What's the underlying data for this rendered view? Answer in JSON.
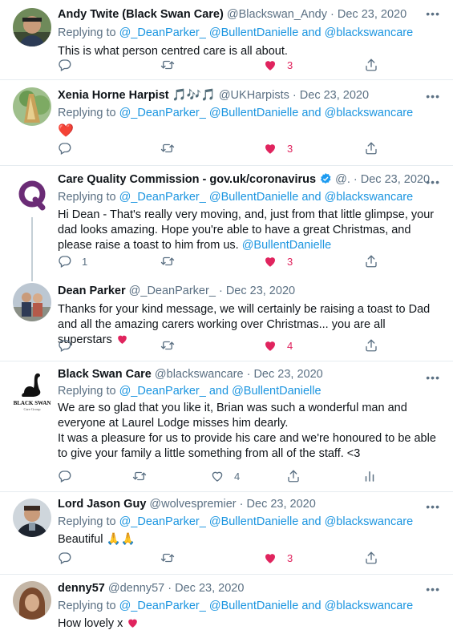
{
  "replying_word": "Replying to",
  "and_word": "and",
  "tweets": [
    {
      "name": "Andy Twite (Black Swan Care)",
      "handle": "@Blackswan_Andy",
      "date": "Dec 23, 2020",
      "replying": [
        "@_DeanParker_",
        "@BullentDanielle",
        "@blackswancare"
      ],
      "text": "This is what person centred care is all about.",
      "reply_count": "",
      "like_count": "3"
    },
    {
      "name": "Xenia Horne Harpist",
      "emoji": "🎵🎶🎵",
      "handle": "@UKHarpists",
      "date": "Dec 23, 2020",
      "replying": [
        "@_DeanParker_",
        "@BullentDanielle",
        "@blackswancare"
      ],
      "text": "❤️",
      "reply_count": "",
      "like_count": "3"
    },
    {
      "name": "Care Quality Commission - gov.uk/coronavirus",
      "handle": "@.",
      "date": "Dec 23, 2020",
      "replying": [
        "@_DeanParker_",
        "@BullentDanielle",
        "@blackswancare"
      ],
      "text": "Hi Dean - That's really very moving, and, just from that little glimpse, your dad looks amazing. Hope you're able to have a great Christmas, and please raise a toast to him from us.",
      "text_link": "@BullentDanielle",
      "reply_count": "1",
      "like_count": "3"
    },
    {
      "name": "Dean Parker",
      "handle": "@_DeanParker_",
      "date": "Dec 23, 2020",
      "text": "Thanks for your kind message, we will certainly be raising a toast to Dad and all the amazing carers working over Christmas... you are all superstars",
      "like_count": "4"
    },
    {
      "name": "Black Swan Care",
      "handle": "@blackswancare",
      "date": "Dec 23, 2020",
      "replying": [
        "@_DeanParker_",
        "@BullentDanielle"
      ],
      "text1": "We are so glad that you like it, Brian was such a wonderful man and everyone at Laurel Lodge misses him dearly.",
      "text2": "It was a pleasure for us to provide his care and we're honoured to be able to give your family a little something from all of the staff. <3",
      "like_count": "4",
      "logo_text": "BLACK SWAN",
      "logo_sub": "Care Group"
    },
    {
      "name": "Lord Jason Guy",
      "handle": "@wolvespremier",
      "date": "Dec 23, 2020",
      "replying": [
        "@_DeanParker_",
        "@BullentDanielle",
        "@blackswancare"
      ],
      "text": "Beautiful",
      "emoji": "🙏🙏",
      "like_count": "3"
    },
    {
      "name": "denny57",
      "handle": "@denny57",
      "date": "Dec 23, 2020",
      "replying": [
        "@_DeanParker_",
        "@BullentDanielle",
        "@blackswancare"
      ],
      "text": "How lovely x"
    }
  ],
  "sep": "·",
  "more": "•••",
  "colors": {
    "link": "#1b95e0",
    "like": "#e0245e",
    "muted": "#5b7083"
  }
}
